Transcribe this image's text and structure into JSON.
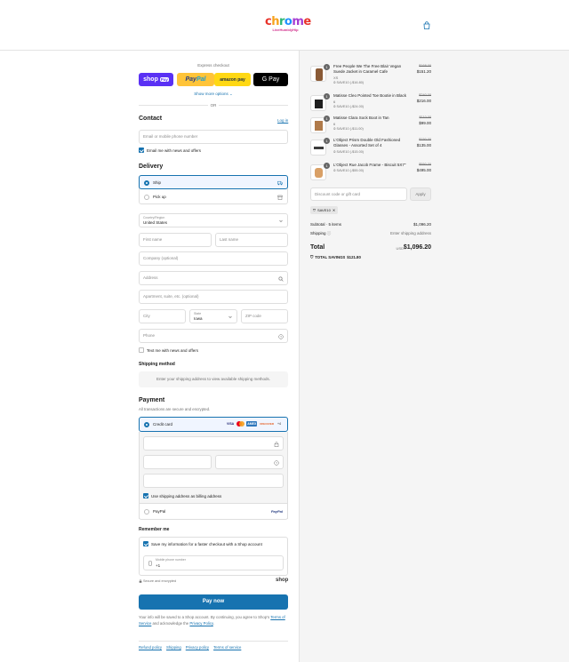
{
  "brand": {
    "logo_letters": [
      "c",
      "h",
      "r",
      "o",
      "m",
      "e"
    ],
    "tagline": "LiveHumblyHip"
  },
  "express": {
    "label": "Express checkout",
    "shop_pay": "shop",
    "shop_pay_chip": "Pay",
    "paypal_a": "Pay",
    "paypal_b": "Pal",
    "amazon": "amazon pay",
    "gpay": "G Pay",
    "more_options": "Show more options ⌄",
    "or": "OR"
  },
  "contact": {
    "heading": "Contact",
    "login_link": "Log in",
    "email_placeholder": "Email or mobile phone number",
    "news_label": "Email me with news and offers"
  },
  "delivery": {
    "heading": "Delivery",
    "options": [
      {
        "label": "Ship",
        "selected": true
      },
      {
        "label": "Pick up",
        "selected": false
      }
    ],
    "country_label": "Country/Region",
    "country_value": "United States",
    "first_name": "First name",
    "last_name": "Last name",
    "company": "Company (optional)",
    "address": "Address",
    "apartment": "Apartment, suite, etc. (optional)",
    "city": "City",
    "state_label": "State",
    "state_value": "Iowa",
    "zip": "ZIP code",
    "phone": "Phone",
    "text_offers": "Text me with news and offers"
  },
  "shipping_method": {
    "heading": "Shipping method",
    "message": "Enter your shipping address to view available shipping methods."
  },
  "payment": {
    "heading": "Payment",
    "subtitle": "All transactions are secure and encrypted.",
    "credit_card_label": "Credit card",
    "card_brands": [
      "VISA",
      "AMEX",
      "DISCOVER",
      "+4"
    ],
    "billing_same_label": "Use shipping address as billing address",
    "paypal_label": "PayPal",
    "paypal_logo": "PayPal"
  },
  "remember": {
    "heading": "Remember me",
    "save_label": "Save my information for a faster checkout with a Shop account",
    "phone_label": "Mobile phone number",
    "phone_value": "+1",
    "secure_note": "Secure and encrypted",
    "shop_logo": "shop"
  },
  "pay_now": "Pay now",
  "fine_print": {
    "text": "Your info will be saved to a Shop account. By continuing, you agree to Shop’s",
    "terms": "Terms of Service",
    "and_ack": "and acknowledge the",
    "privacy": "Privacy Policy",
    "period": "."
  },
  "footer_links": [
    "Refund policy",
    "Shipping",
    "Privacy policy",
    "Terms of service"
  ],
  "cart": {
    "items": [
      {
        "qty": "1",
        "name": "Free People We The Free Blair Vegan Suede Jacket in Caramel Cafe",
        "variant": "XS",
        "discount": "SAVE10 (-$16.80)",
        "old_price": "$168.00",
        "price": "$151.20",
        "thumb_color": "#8a5a36"
      },
      {
        "qty": "1",
        "name": "Matisse Cleo Pointed Toe Bootie in Black",
        "variant": "6",
        "discount": "SAVE10 (-$24.00)",
        "old_price": "$240.00",
        "price": "$216.00",
        "thumb_color": "#1f1f1f"
      },
      {
        "qty": "1",
        "name": "Matisse Clara Sock Boot in Tan",
        "variant": "6",
        "discount": "SAVE10 (-$11.00)",
        "old_price": "$110.00",
        "price": "$99.00",
        "thumb_color": "#b07a4a"
      },
      {
        "qty": "1",
        "name": "L'Object Prism Double Old Fashioned Glasses - Assorted Set of 4",
        "variant": "",
        "discount": "SAVE10 (-$15.00)",
        "old_price": "$150.00",
        "price": "$135.00",
        "thumb_color": "#3b3b3b"
      },
      {
        "qty": "1",
        "name": "L'Object Rue Jacob Frame - Biscuit 5X7\"",
        "variant": "",
        "discount": "SAVE10 (-$55.00)",
        "old_price": "$550.00",
        "price": "$495.00",
        "thumb_color": "#d9a066"
      }
    ],
    "discount_placeholder": "Discount code or gift card",
    "apply_label": "Apply",
    "applied_code": "SAVE10",
    "subtotal_label": "Subtotal · 5 items",
    "subtotal_value": "$1,096.20",
    "shipping_label": "Shipping",
    "shipping_value": "Enter shipping address",
    "total_label": "Total",
    "currency": "USD",
    "total_value": "$1,096.20",
    "savings_label": "TOTAL SAVINGS",
    "savings_value": "$121.80"
  },
  "colors": {
    "accent": "#1773b0",
    "shop_purple": "#5a31f4",
    "paypal_yellow": "#ffc439",
    "amazon_yellow": "#ffd814"
  }
}
